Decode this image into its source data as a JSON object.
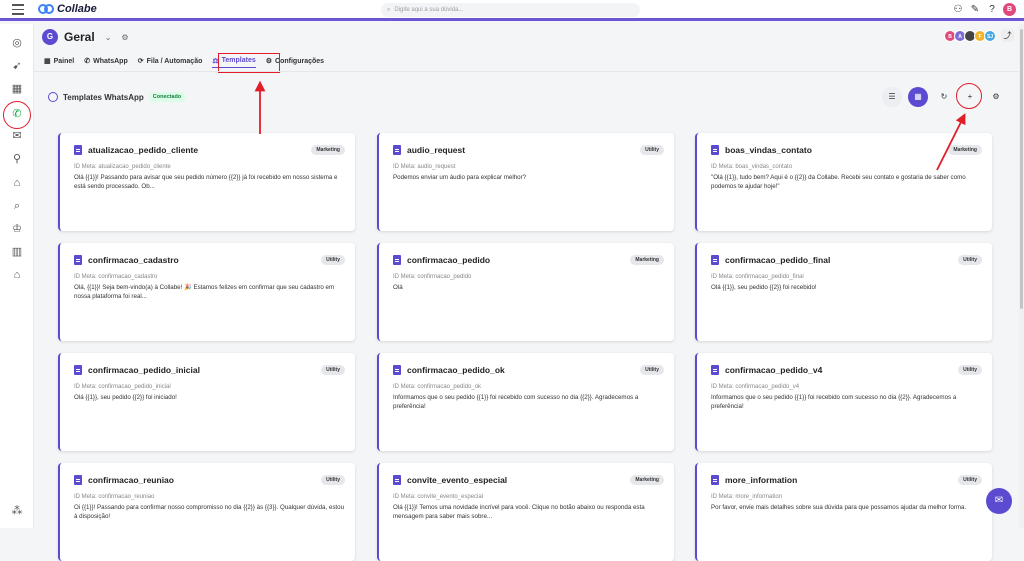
{
  "topbar": {
    "logo": "Collabe",
    "search_placeholder": "Digite aqui a sua dúvida...",
    "user_avatar": "B"
  },
  "workspace": {
    "badge": "G",
    "name": "Geral"
  },
  "members": [
    {
      "initials": "B",
      "color": "#e04a7a"
    },
    {
      "initials": "A",
      "color": "#7c6cd8"
    },
    {
      "initials": "",
      "color": "#444"
    },
    {
      "initials": "F",
      "color": "#f0b429"
    },
    {
      "initials": "SJ",
      "color": "#4aa8e0"
    }
  ],
  "nav": {
    "tabs": [
      {
        "label": "Painel",
        "icon": "grid-icon"
      },
      {
        "label": "WhatsApp",
        "icon": "whatsapp-icon"
      },
      {
        "label": "Fila / Automação",
        "icon": "queue-icon"
      },
      {
        "label": "Templates",
        "icon": "template-icon",
        "active": true
      },
      {
        "label": "Configurações",
        "icon": "gear-icon"
      }
    ]
  },
  "page": {
    "title": "Templates WhatsApp",
    "status": "Conectado"
  },
  "templates": [
    {
      "name": "atualizacao_pedido_cliente",
      "category": "Marketing",
      "meta": "ID Meta: atualizacao_pedido_cliente",
      "body": "Olá {{1}}! Passando para avisar que seu pedido número {{2}} já foi recebido em nosso sistema e está sendo processado. Ob..."
    },
    {
      "name": "audio_request",
      "category": "Utility",
      "meta": "ID Meta: audio_request",
      "body": "Podemos enviar um áudio para explicar melhor?"
    },
    {
      "name": "boas_vindas_contato",
      "category": "Marketing",
      "meta": "ID Meta: boas_vindas_contato",
      "body": "\"Olá {{1}}, tudo bem? Aqui é o {{2}} da Collabe. Recebi seu contato e gostaria de saber como podemos te ajudar hoje!\""
    },
    {
      "name": "confirmacao_cadastro",
      "category": "Utility",
      "meta": "ID Meta: confirmacao_cadastro",
      "body": "Olá, {{1}}! Seja bem-vindo(a) à Collabe! 🎉 Estamos felizes em confirmar que seu cadastro em nossa plataforma foi real..."
    },
    {
      "name": "confirmacao_pedido",
      "category": "Marketing",
      "meta": "ID Meta: confirmacao_pedido",
      "body": "Olá"
    },
    {
      "name": "confirmacao_pedido_final",
      "category": "Utility",
      "meta": "ID Meta: confirmacao_pedido_final",
      "body": "Olá {{1}}, seu pedido {{2}} foi recebido!"
    },
    {
      "name": "confirmacao_pedido_inicial",
      "category": "Utility",
      "meta": "ID Meta: confirmacao_pedido_inicial",
      "body": "Olá {{1}}, seu pedido {{2}} foi iniciado!"
    },
    {
      "name": "confirmacao_pedido_ok",
      "category": "Utility",
      "meta": "ID Meta: confirmacao_pedido_ok",
      "body": "Informamos que o seu pedido {{1}} foi recebido com sucesso no dia {{2}}. Agradecemos a preferência!"
    },
    {
      "name": "confirmacao_pedido_v4",
      "category": "Utility",
      "meta": "ID Meta: confirmacao_pedido_v4",
      "body": "Informamos que o seu pedido {{1}} foi recebido com sucesso no dia {{2}}. Agradecemos a preferência!"
    },
    {
      "name": "confirmacao_reuniao",
      "category": "Utility",
      "meta": "ID Meta: confirmacao_reuniao",
      "body": "Oi {{1}}! Passando para confirmar nosso compromisso no dia {{2}} às {{3}}. Qualquer dúvida, estou à disposição!"
    },
    {
      "name": "convite_evento_especial",
      "category": "Marketing",
      "meta": "ID Meta: convite_evento_especial",
      "body": "Olá {{1}}! Temos uma novidade incrível para você. Clique no botão abaixo ou responda esta mensagem para saber mais sobre..."
    },
    {
      "name": "more_information",
      "category": "Utility",
      "meta": "ID Meta: more_information",
      "body": "Por favor, envie mais detalhes sobre sua dúvida para que possamos ajudar da melhor forma."
    }
  ],
  "colors": {
    "accent": "#5b4bd1",
    "annotation": "#e11d2a",
    "status_bg": "#dcfce7",
    "status_fg": "#15803d"
  }
}
